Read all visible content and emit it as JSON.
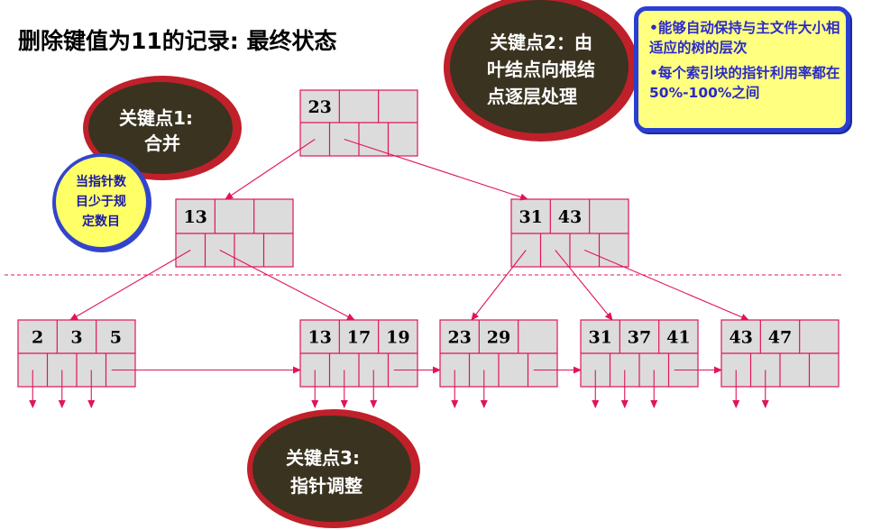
{
  "title": "删除键值为11的记录: 最终状态",
  "callouts": {
    "point1": [
      "关键点1:",
      "合并"
    ],
    "point2": [
      "关键点2：由",
      "叶结点向根结",
      "点逐层处理"
    ],
    "point3": [
      "关键点3:",
      "指针调整"
    ]
  },
  "hint_circle": [
    "当指针数",
    "目少于规",
    "定数目"
  ],
  "note": [
    "•能够自动保持与主文件大小相适应的树的层次",
    "•每个索引块的指针利用率都在50%-100%之间"
  ],
  "tree": {
    "root": {
      "keys": [
        "23",
        "",
        ""
      ]
    },
    "internal": [
      {
        "keys": [
          "13",
          "",
          ""
        ]
      },
      {
        "keys": [
          "31",
          "43",
          ""
        ]
      }
    ],
    "leaves": [
      {
        "keys": [
          "2",
          "3",
          "5"
        ]
      },
      {
        "keys": [
          "13",
          "17",
          "19"
        ]
      },
      {
        "keys": [
          "23",
          "29",
          ""
        ]
      },
      {
        "keys": [
          "31",
          "37",
          "41"
        ]
      },
      {
        "keys": [
          "43",
          "47",
          ""
        ]
      }
    ]
  },
  "colors": {
    "node_fill": "#dcdcdc",
    "node_border": "#e0145c",
    "arrow": "#e0145c",
    "oval_fill": "#3a3320",
    "oval_ring": "#c0202a",
    "hint_fill": "#ffff66",
    "hint_ring": "#3344cc",
    "note_border": "#2a3ed4",
    "note_fill": "#ffff80"
  }
}
